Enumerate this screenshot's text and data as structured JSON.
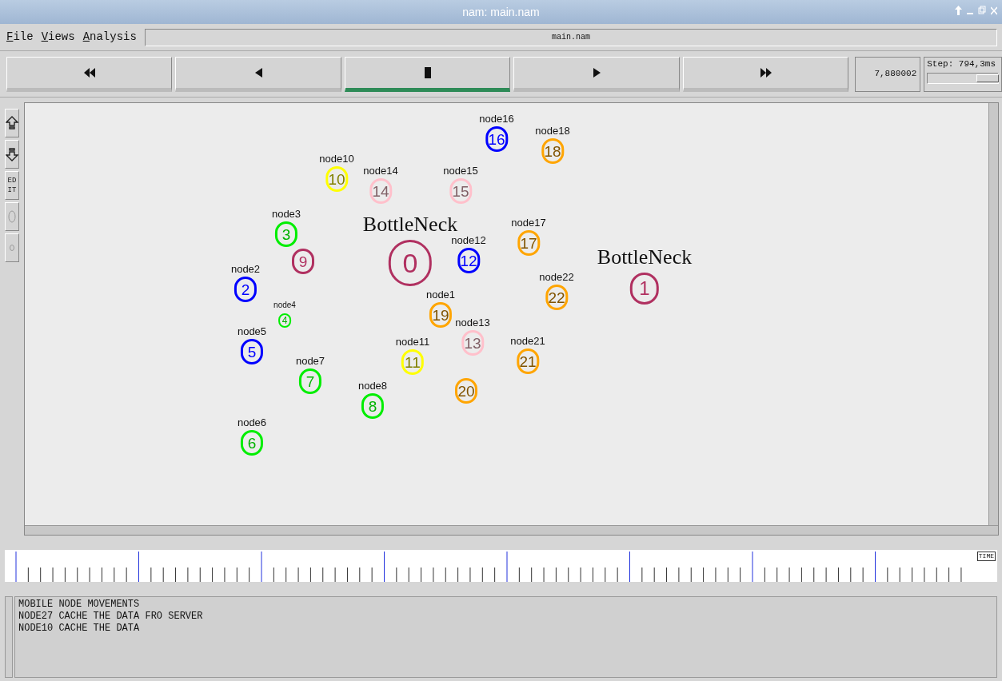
{
  "window": {
    "title": "nam: main.nam"
  },
  "menu": [
    "File",
    "Views",
    "Analysis"
  ],
  "file_field": "main.nam",
  "playback": [
    {
      "kind": "rewind",
      "selected": false
    },
    {
      "kind": "back",
      "selected": false
    },
    {
      "kind": "stop",
      "selected": true
    },
    {
      "kind": "play",
      "selected": false
    },
    {
      "kind": "forward",
      "selected": false
    }
  ],
  "time": "7,880002",
  "step": {
    "label": "Step: 794,3ms",
    "level": 0.85
  },
  "side_tools": [
    {
      "kind": "zoom-in"
    },
    {
      "kind": "zoom-out"
    },
    {
      "kind": "edit",
      "label": "EDIT"
    },
    {
      "kind": "circle"
    },
    {
      "kind": "small-circle"
    }
  ],
  "nodes": [
    {
      "number": "0",
      "color": "#b03060",
      "label": "BottleNeck",
      "kind": "big"
    },
    {
      "number": "2",
      "color": "#0000ff",
      "label": "node2",
      "kind": "normal"
    },
    {
      "number": "3",
      "color": "#00ee00",
      "label": "node3",
      "kind": "normal"
    },
    {
      "number": "4",
      "color": "#00ee00",
      "label": "node4",
      "kind": "small"
    },
    {
      "number": "5",
      "color": "#0000ff",
      "label": "node5",
      "kind": "normal"
    },
    {
      "number": "6",
      "color": "#00ee00",
      "label": "node6",
      "kind": "normal"
    },
    {
      "number": "7",
      "color": "#00ee00",
      "label": "node7",
      "kind": "normal"
    },
    {
      "number": "8",
      "color": "#00ee00",
      "label": "node8",
      "kind": "normal"
    },
    {
      "number": "9",
      "color": "#b03060",
      "kind": "normal"
    },
    {
      "number": "10",
      "color": "#ffff00",
      "label": "node10",
      "kind": "normal"
    },
    {
      "number": "11",
      "color": "#ffff00",
      "label": "node11",
      "kind": "normal"
    },
    {
      "number": "12",
      "color": "#0000ff",
      "label": "node12",
      "kind": "normal"
    },
    {
      "number": "13",
      "color": "#ffc0cb",
      "label": "node13",
      "kind": "normal"
    },
    {
      "number": "14",
      "color": "#ffc0cb",
      "label": "node14",
      "kind": "normal"
    },
    {
      "number": "15",
      "color": "#ffc0cb",
      "label": "node15",
      "kind": "normal"
    },
    {
      "number": "16",
      "color": "#0000ff",
      "label": "node16",
      "kind": "normal"
    },
    {
      "number": "17",
      "color": "#ffa500",
      "label": "node17",
      "kind": "normal"
    },
    {
      "number": "18",
      "color": "#ffa500",
      "label": "node18",
      "kind": "normal"
    },
    {
      "number": "19",
      "color": "#ffa500",
      "label": "node1",
      "kind": "normal"
    },
    {
      "number": "20",
      "color": "#ffa500",
      "kind": "normal"
    },
    {
      "number": "21",
      "color": "#ffa500",
      "label": "node21",
      "kind": "normal"
    },
    {
      "number": "22",
      "color": "#ffa500",
      "label": "node22",
      "kind": "normal"
    },
    {
      "number": "1",
      "color": "#b03060",
      "label": "BottleNeck",
      "kind": "bottleneck"
    }
  ],
  "timeline": {
    "label": "TIME"
  },
  "annotations": [
    "MOBILE NODE MOVEMENTS",
    "NODE27 CACHE THE DATA FRO SERVER",
    "NODE10 CACHE THE DATA"
  ]
}
